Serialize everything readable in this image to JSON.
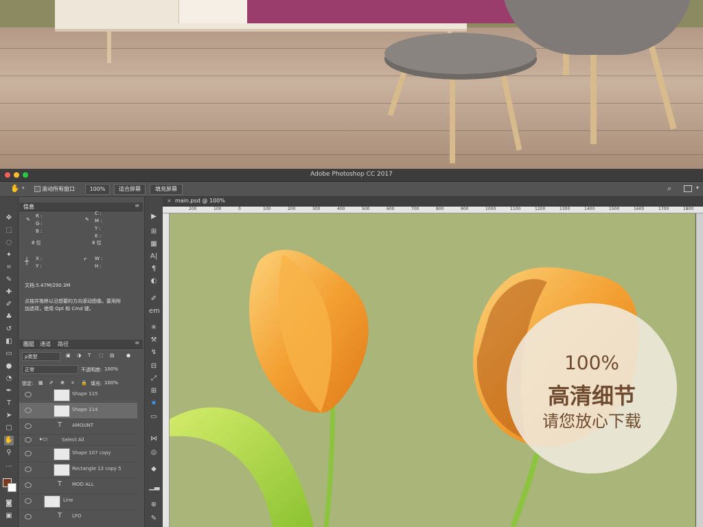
{
  "window": {
    "title": "Adobe Photoshop CC 2017"
  },
  "options_bar": {
    "scroll_all_label": "滚动所有窗口",
    "zoom_value": "100%",
    "fit_screen_label": "适合屏幕",
    "fill_screen_label": "填充屏幕"
  },
  "info_panel": {
    "tab_label": "信息",
    "r_label": "R :",
    "g_label": "G :",
    "b_label": "B :",
    "bit_left": "8 位",
    "c_label": "C :",
    "m_label": "M :",
    "y_label": "Y :",
    "k_label": "K :",
    "bit_right": "8 位",
    "x_label": "X :",
    "y2_label": "Y :",
    "w_label": "W :",
    "h_label": "H :",
    "doc_size": "文档:5.47M/290.3M",
    "hint_line1": "点按并拖移以沿想要的方向滚动图像。要用附",
    "hint_line2": "加选项，使用 Opt 和 Cmd 键。"
  },
  "layers_panel": {
    "tabs": [
      "图层",
      "通道",
      "路径"
    ],
    "filter_label": "ρ类型",
    "blend_mode": "正常",
    "opacity_label": "不透明度:",
    "opacity_value": "100%",
    "lock_label": "锁定:",
    "fill_label": "填充:",
    "fill_value": "100%",
    "layers": [
      {
        "name": "Shape 115"
      },
      {
        "name": "Shape 114"
      },
      {
        "name": "AMOUNT"
      },
      {
        "name": "Select All"
      },
      {
        "name": "Shape 107 copy"
      },
      {
        "name": "Rectangle 13 copy 5"
      },
      {
        "name": "MOD ALL"
      },
      {
        "name": "Line"
      },
      {
        "name": "LFO"
      }
    ]
  },
  "document": {
    "tab_label": "main.psd @ 100%",
    "ruler_ticks": [
      "200",
      "100",
      "0",
      "100",
      "200",
      "300",
      "400",
      "500",
      "600",
      "700",
      "800",
      "900",
      "1000",
      "1100",
      "1200",
      "1300",
      "1400",
      "1500",
      "1600",
      "1700",
      "1800"
    ]
  },
  "promo": {
    "percent": "100%",
    "headline": "高清细节",
    "subline": "请您放心下载"
  },
  "colors": {
    "canvas_bg": "#a9b579",
    "tulip_orange": "#f0a030",
    "leaf_green": "#9ccc3a",
    "promo_text": "#6e4a2f"
  }
}
